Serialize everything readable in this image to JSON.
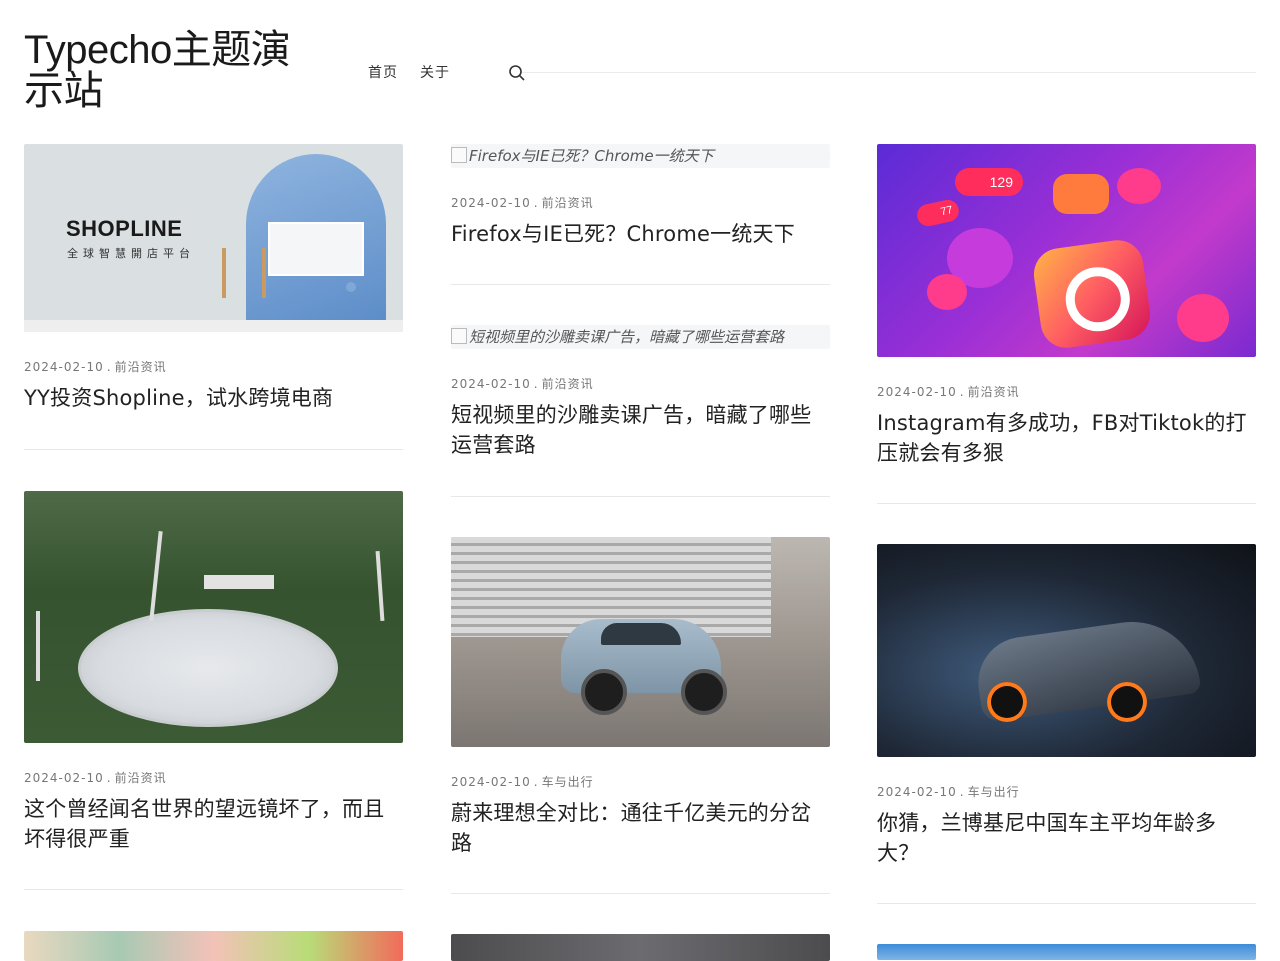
{
  "site": {
    "title": "Typecho主题演示站"
  },
  "nav": {
    "items": [
      "首页",
      "关于"
    ],
    "search_icon": "search-icon"
  },
  "posts": [
    {
      "column": 1,
      "thumb": "shopline",
      "thumb_text": {
        "brand": "SHOPLINE",
        "subtitle": "全球智慧開店平台"
      },
      "date": "2024-02-10",
      "category": "前沿资讯",
      "title": "YY投资Shopline，试水跨境电商"
    },
    {
      "column": 2,
      "thumb": "broken",
      "alt": "Firefox与IE已死？Chrome一统天下",
      "date": "2024-02-10",
      "category": "前沿资讯",
      "title": "Firefox与IE已死？Chrome一统天下"
    },
    {
      "column": 3,
      "thumb": "instagram",
      "thumb_text": {
        "likes": "129",
        "likes_small": "77"
      },
      "date": "2024-02-10",
      "category": "前沿资讯",
      "title": "Instagram有多成功，FB对Tiktok的打压就会有多狠"
    },
    {
      "column": 2,
      "thumb": "broken",
      "alt": "短视频里的沙雕卖课广告，暗藏了哪些运营套路",
      "date": "2024-02-10",
      "category": "前沿资讯",
      "title": "短视频里的沙雕卖课广告，暗藏了哪些运营套路"
    },
    {
      "column": 1,
      "thumb": "telescope",
      "date": "2024-02-10",
      "category": "前沿资讯",
      "title": "这个曾经闻名世界的望远镜坏了，而且坏得很严重"
    },
    {
      "column": 2,
      "thumb": "suv",
      "date": "2024-02-10",
      "category": "车与出行",
      "title": "蔚来理想全对比：通往千亿美元的分岔路"
    },
    {
      "column": 3,
      "thumb": "supercar",
      "date": "2024-02-10",
      "category": "车与出行",
      "title": "你猜，兰博基尼中国车主平均年龄多大？"
    }
  ],
  "meta_separator": "."
}
